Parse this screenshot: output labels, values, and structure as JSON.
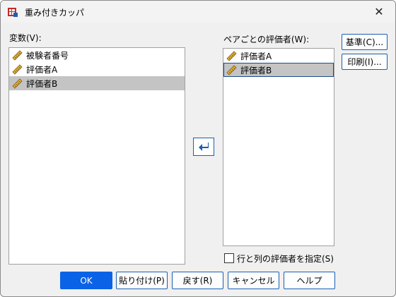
{
  "window": {
    "title": "重み付きカッパ",
    "close_glyph": "✕"
  },
  "variables": {
    "label": "変数(V):",
    "items": [
      {
        "label": "被験者番号",
        "icon": "ruler-icon",
        "selected": false
      },
      {
        "label": "評価者A",
        "icon": "ruler-icon",
        "selected": false
      },
      {
        "label": "評価者B",
        "icon": "ruler-icon",
        "selected": true
      }
    ]
  },
  "pairwise": {
    "label": "ペアごとの評価者(W):",
    "items": [
      {
        "label": "評価者A",
        "icon": "ruler-icon",
        "selected": false
      },
      {
        "label": "評価者B",
        "icon": "ruler-icon",
        "selected": true
      }
    ]
  },
  "side_buttons": {
    "criteria": "基準(C)...",
    "print": "印刷(I)..."
  },
  "checkbox": {
    "label": "行と列の評価者を指定(S)",
    "checked": false
  },
  "footer": {
    "ok": "OK",
    "paste": "貼り付け(P)",
    "reset": "戻す(R)",
    "cancel": "キャンセル",
    "help": "ヘルプ"
  },
  "colors": {
    "accent": "#0a62e6",
    "selection": "#c4c4c4",
    "border_blue": "#1a5fb4"
  }
}
